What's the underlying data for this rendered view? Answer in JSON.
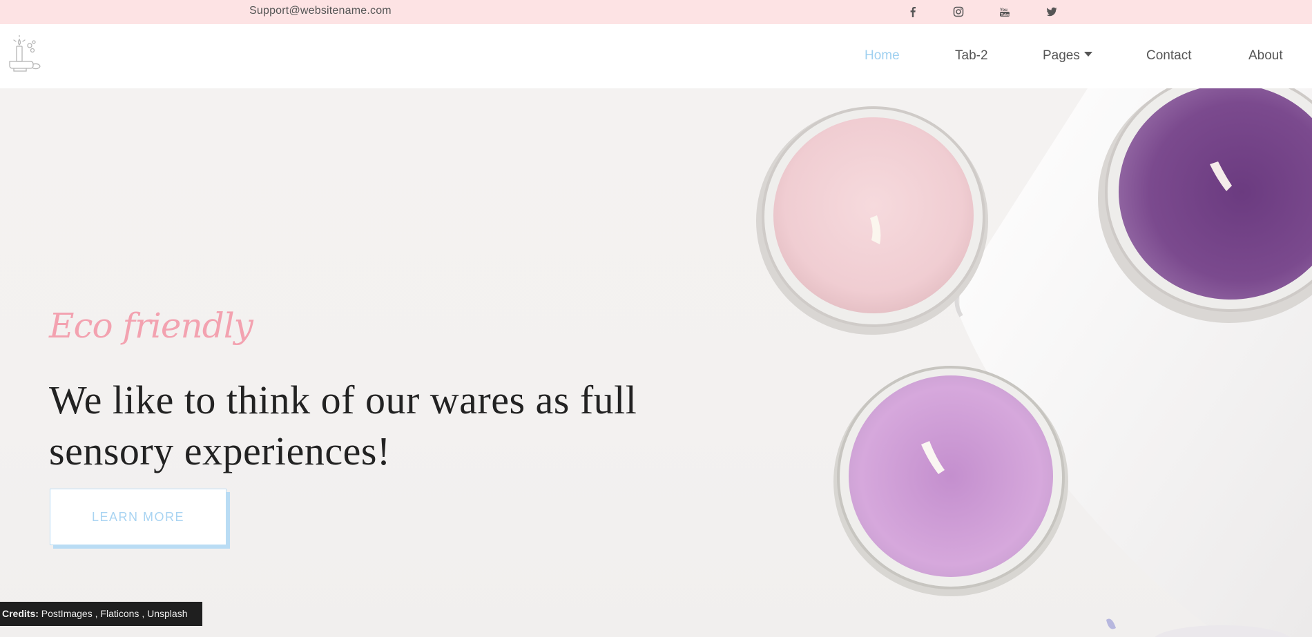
{
  "topbar": {
    "email": "Support@websitename.com",
    "social": [
      "facebook-icon",
      "instagram-icon",
      "youtube-icon",
      "twitter-icon"
    ]
  },
  "nav": {
    "items": [
      {
        "label": "Home",
        "active": true
      },
      {
        "label": "Tab-2"
      },
      {
        "label": "Pages",
        "dropdown": true
      },
      {
        "label": "Contact"
      },
      {
        "label": "About"
      }
    ]
  },
  "hero": {
    "eyebrow": "Eco friendly",
    "headline_line1": "We like to think of our wares as full",
    "headline_line2": "sensory experiences!",
    "cta": "LEARN MORE"
  },
  "credits": {
    "label": "Credits:",
    "links": [
      "PostImages",
      "Flaticons",
      "Unsplash"
    ],
    "sep": " , "
  },
  "colors": {
    "topbar_bg": "#fde3e4",
    "accent_blue": "#9fd0f0",
    "accent_pink": "#f3a2b0",
    "button_border": "#b9dcf4"
  }
}
